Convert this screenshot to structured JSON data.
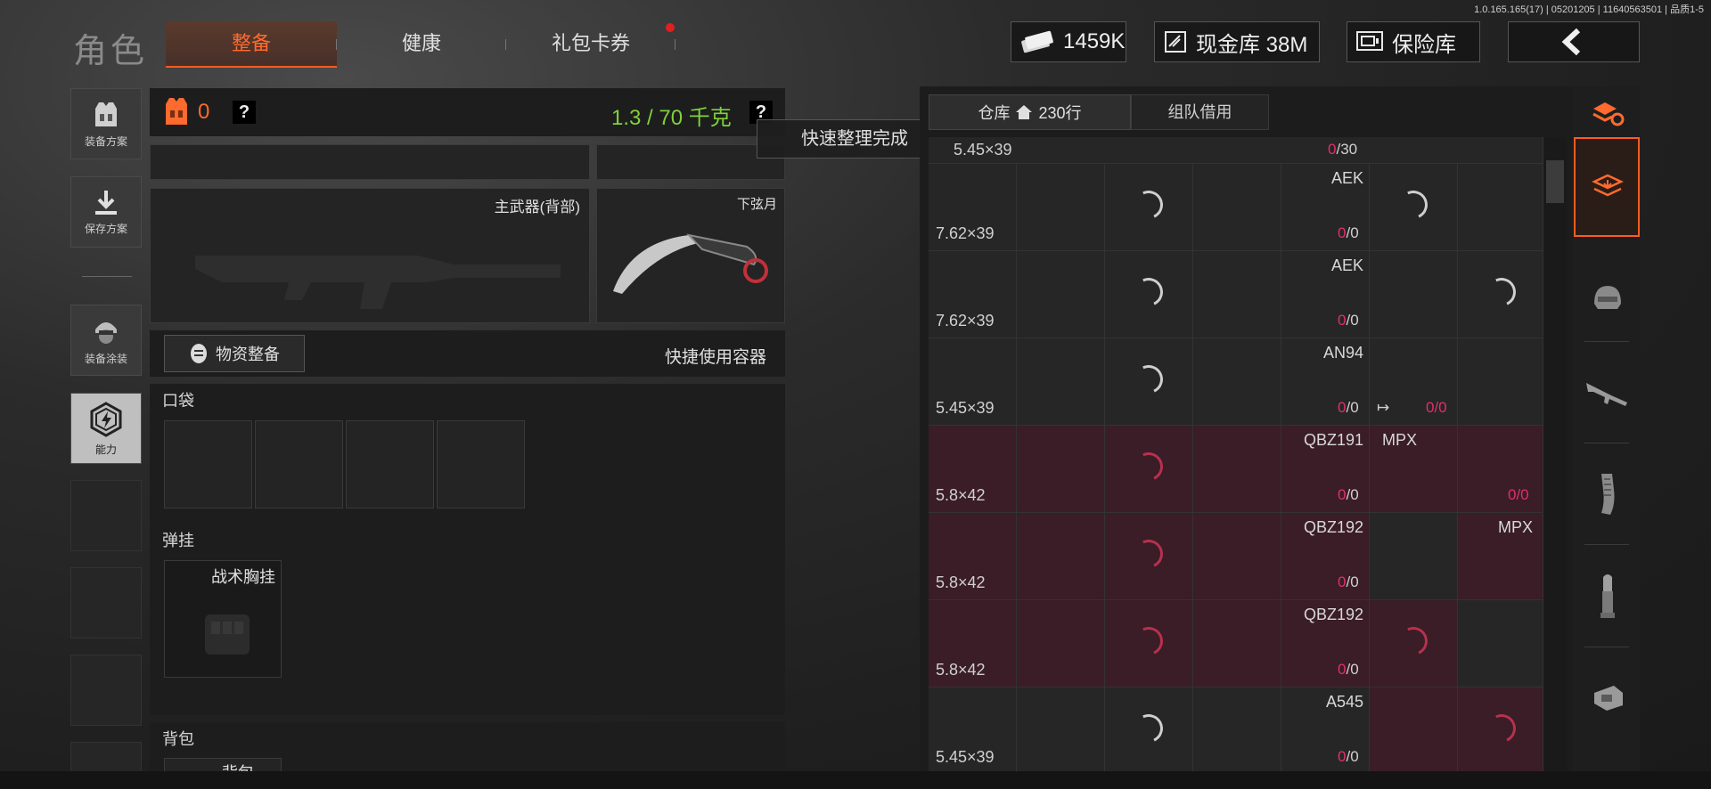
{
  "version": "1.0.165.165(17) | 05201205 | 11640563501 | 品质1-5",
  "title": "角色",
  "tabs": [
    {
      "label": "整备",
      "active": true
    },
    {
      "label": "健康",
      "active": false
    },
    {
      "label": "礼包卡券",
      "active": false,
      "badge": true
    }
  ],
  "currency": {
    "cash": "1459K",
    "vault_label": "现金库 38M",
    "safe_label": "保险库"
  },
  "sidebar": [
    {
      "label": "装备方案",
      "icon": "vest-icon"
    },
    {
      "label": "保存方案",
      "icon": "download-icon"
    },
    {
      "label": "装备涂装",
      "icon": "helmet-soldier-icon"
    },
    {
      "label": "能力",
      "icon": "ability-hex-icon",
      "active": true
    }
  ],
  "loadout": {
    "armor_value": "0",
    "help": "?",
    "weight": "1.3 / 70 千克",
    "primary_label": "主武器(背部)",
    "melee_label": "下弦月",
    "supplies_button": "物资整备",
    "quick_container": "快捷使用容器",
    "pockets_label": "口袋",
    "rig_label": "弹挂",
    "rig_item": "战术胸挂",
    "backpack_label": "背包",
    "backpack_item": "背包"
  },
  "toast": "快速整理完成",
  "warehouse": {
    "tab_storage": "仓库",
    "rows": "230行",
    "tab_team": "组队借用",
    "first_row": {
      "caliber": "5.45×39",
      "count_red": "0",
      "count_total": "/30"
    },
    "rows_data": [
      {
        "caliber": "7.62×39",
        "name": "AEK",
        "count_red": "0",
        "count_total": "/0",
        "highlight": false
      },
      {
        "caliber": "7.62×39",
        "name": "AEK",
        "count_red": "0",
        "count_total": "/0",
        "highlight": false
      },
      {
        "caliber": "5.45×39",
        "name": "AN94",
        "count_red": "0",
        "count_total": "/0",
        "extra": "0/0",
        "highlight": false
      },
      {
        "caliber": "5.8×42",
        "name": "QBZ191",
        "count_red": "0",
        "count_total": "/0",
        "name2": "MPX",
        "extra": "0/0",
        "highlight": true
      },
      {
        "caliber": "5.8×42",
        "name": "QBZ192",
        "count_red": "0",
        "count_total": "/0",
        "name2": "MPX",
        "highlight": true
      },
      {
        "caliber": "5.8×42",
        "name": "QBZ192",
        "count_red": "0",
        "count_total": "/0",
        "highlight": true
      },
      {
        "caliber": "5.45×39",
        "name": "A545",
        "count_red": "0",
        "count_total": "/0",
        "highlight": false
      }
    ]
  },
  "colors": {
    "accent": "#ff6a2e",
    "weight_green": "#7fd13a",
    "count_red": "#e0306a",
    "row_highlight": "#3a1d26"
  }
}
